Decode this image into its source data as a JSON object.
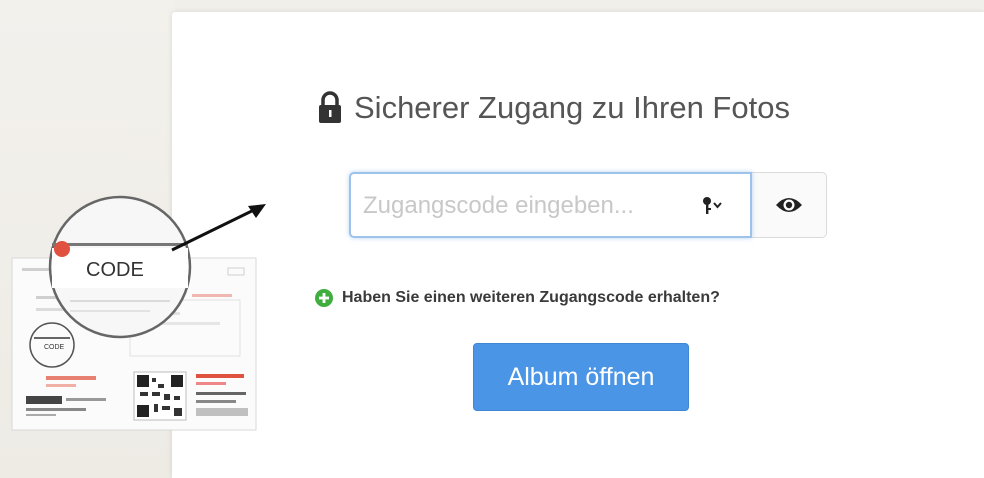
{
  "header": {
    "title": "Sicherer Zugang zu Ihren Fotos",
    "icon": "lock-icon"
  },
  "code_form": {
    "placeholder": "Zugangscode eingeben...",
    "value": "",
    "key_icon": "key-dropdown-icon",
    "toggle_icon": "eye-icon"
  },
  "more_code_link": {
    "label": "Haben Sie einen weiteren Zugangscode erhalten?",
    "icon": "plus-circle-icon"
  },
  "open_button": {
    "label": "Album öffnen"
  },
  "illustration": {
    "magnifier_label": "CODE",
    "small_code_label": "CODE"
  },
  "colors": {
    "primary": "#4a95e6",
    "success": "#3fae3f",
    "badge": "#e0513f"
  }
}
